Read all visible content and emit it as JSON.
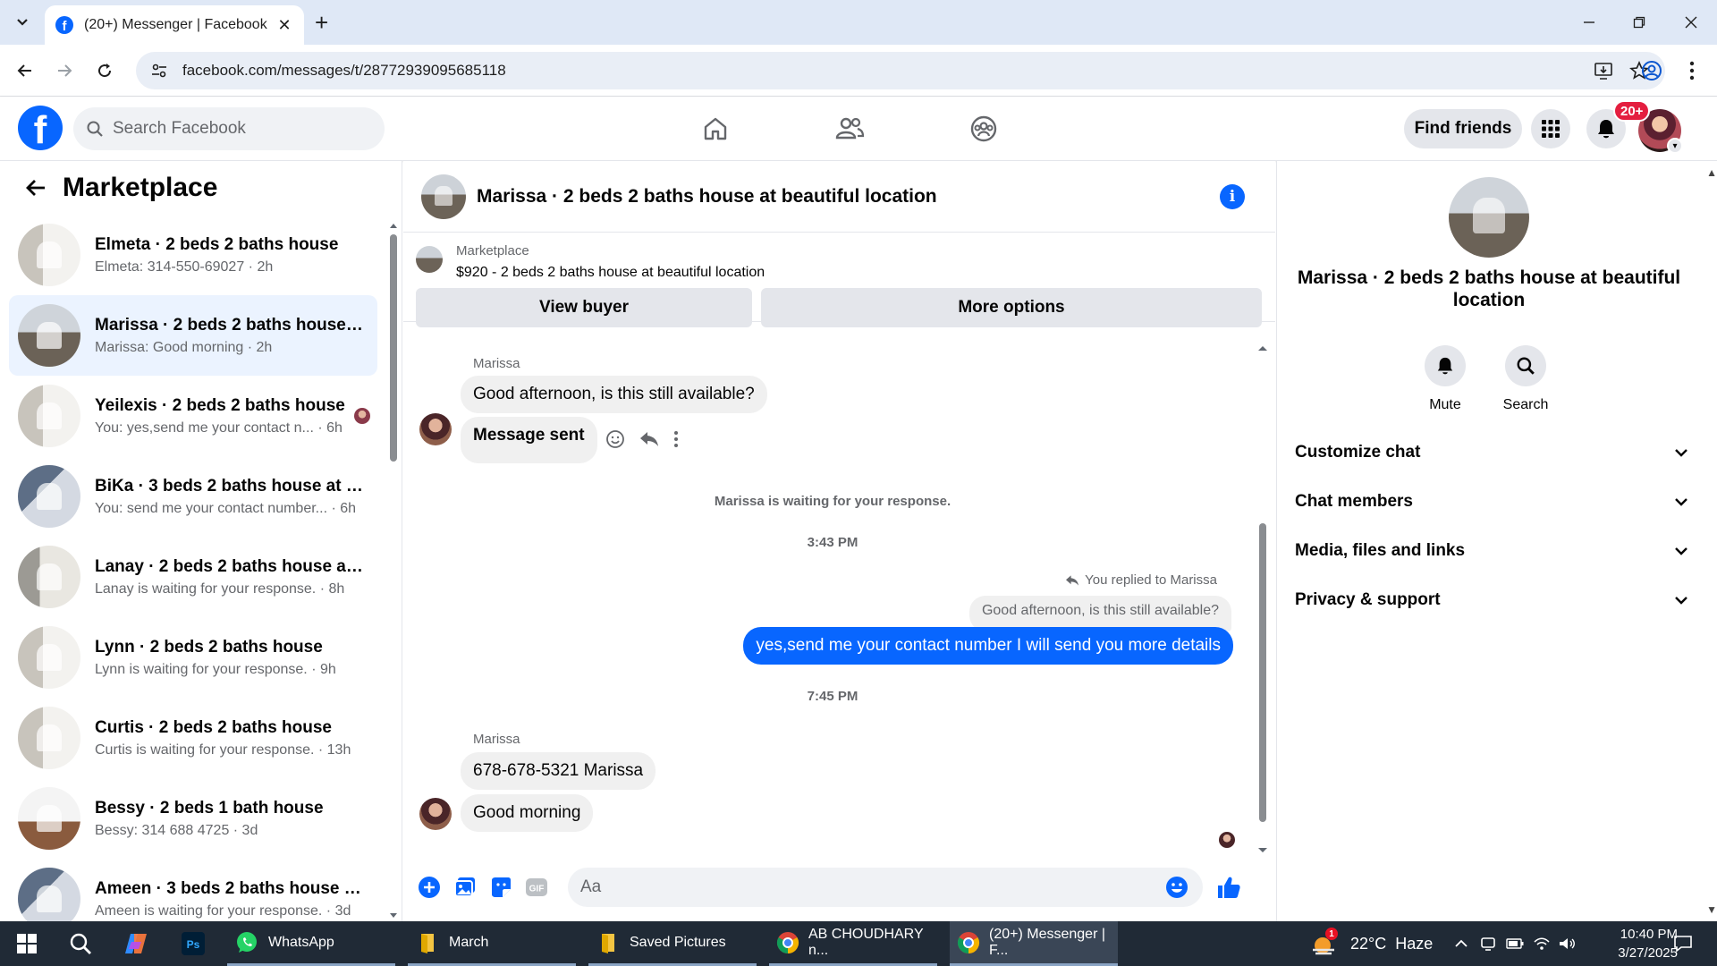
{
  "browser": {
    "tab_title": "(20+) Messenger | Facebook",
    "url": "facebook.com/messages/t/28772939095685118"
  },
  "fb_header": {
    "search_placeholder": "Search Facebook",
    "find_friends_label": "Find friends",
    "notification_badge": "20+"
  },
  "left_pane": {
    "title": "Marketplace",
    "chats": [
      {
        "name": "Elmeta · 2 beds 2 baths house",
        "preview": "Elmeta: 314-550-69027 · 2h",
        "active": false
      },
      {
        "name": "Marissa · 2 beds 2 baths house a...",
        "preview": "Marissa: Good morning · 2h",
        "active": true
      },
      {
        "name": "Yeilexis · 2 beds 2 baths house",
        "preview": "You: yes,send me your contact n... · 6h",
        "active": false
      },
      {
        "name": "BiKa · 3 beds 2 baths house at b...",
        "preview": "You: send me your contact number... · 6h",
        "active": false
      },
      {
        "name": "Lanay · 2 beds 2 baths house at ...",
        "preview": "Lanay is waiting for your response. · 8h",
        "active": false
      },
      {
        "name": "Lynn · 2 beds 2 baths house",
        "preview": "Lynn is waiting for your response. · 9h",
        "active": false
      },
      {
        "name": "Curtis · 2 beds 2 baths house",
        "preview": "Curtis is waiting for your response. · 13h",
        "active": false
      },
      {
        "name": "Bessy · 2 beds 1 bath house",
        "preview": "Bessy: 314 688 4725 · 3d",
        "active": false
      },
      {
        "name": "Ameen · 3 beds 2 baths house a...",
        "preview": "Ameen is waiting for your response. · 3d",
        "active": false
      }
    ]
  },
  "conversation": {
    "title": "Marissa · 2 beds 2 baths house at beautiful location",
    "marketplace_label": "Marketplace",
    "listing": "$920 - 2 beds 2 baths house at beautiful location",
    "view_buyer_label": "View buyer",
    "more_options_label": "More options",
    "sender_name_1": "Marissa",
    "msg_1": "Good afternoon, is this still available?",
    "msg_2": "Message sent",
    "waiting_note": "Marissa is waiting for your response.",
    "time_1": "3:43 PM",
    "replied_note": "You replied to Marissa",
    "quoted_msg": "Good afternoon, is this still available?",
    "my_reply": "yes,send me your contact number I will send you more details",
    "time_2": "7:45 PM",
    "sender_name_2": "Marissa",
    "msg_3": "678-678-5321 Marissa",
    "msg_4": "Good morning",
    "composer_placeholder": "Aa"
  },
  "right_pane": {
    "name": "Marissa · 2 beds 2 baths house at beautiful location",
    "mute_label": "Mute",
    "search_label": "Search",
    "sections": [
      "Customize chat",
      "Chat members",
      "Media, files and links",
      "Privacy & support"
    ]
  },
  "taskbar": {
    "apps": [
      {
        "label": "WhatsApp",
        "active": false
      },
      {
        "label": "March",
        "active": false
      },
      {
        "label": "Saved Pictures",
        "active": false
      },
      {
        "label": "AB CHOUDHARY n...",
        "active": false
      },
      {
        "label": "(20+) Messenger | F...",
        "active": true
      }
    ],
    "weather": "22°C  Haze",
    "weather_badge": "1",
    "time": "10:40 PM",
    "date": "3/27/2025"
  },
  "colors": {
    "fb_blue": "#0866ff",
    "active_chat_bg": "#ebf3ff",
    "taskbar_bg": "#202a36"
  }
}
